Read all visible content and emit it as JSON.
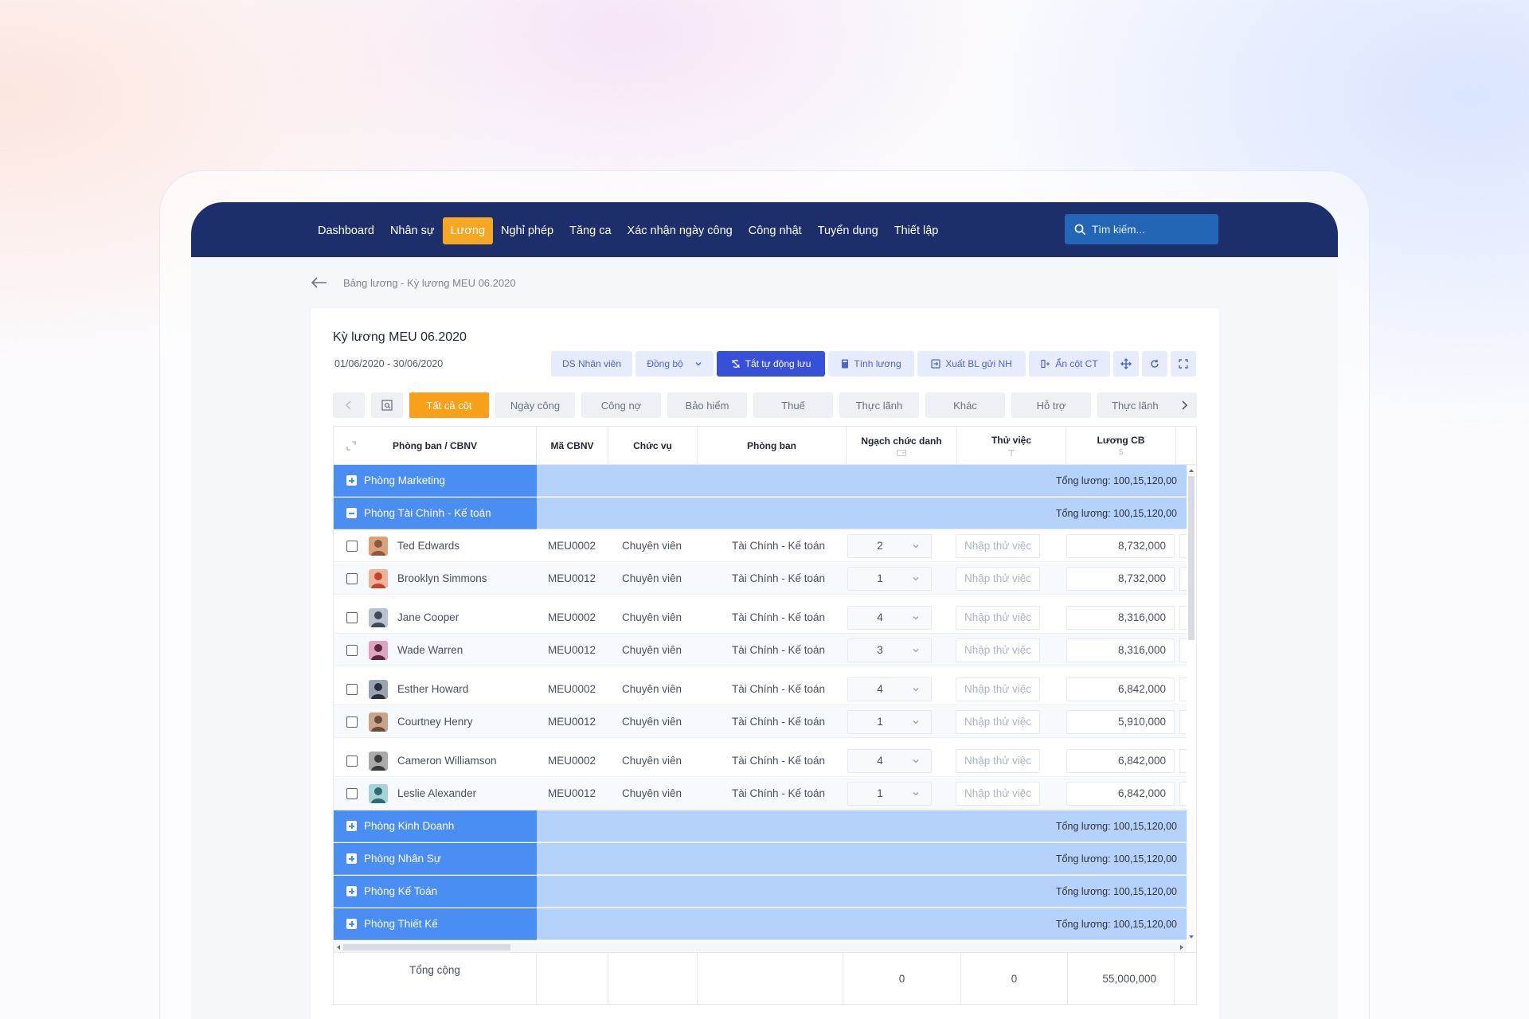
{
  "nav": {
    "items": [
      "Dashboard",
      "Nhân sự",
      "Lương",
      "Nghỉ phép",
      "Tăng ca",
      "Xác nhận ngày công",
      "Công nhật",
      "Tuyển dụng",
      "Thiết lập"
    ],
    "active_index": 2
  },
  "search": {
    "placeholder": "Tìm kiếm..."
  },
  "breadcrumb": "Bảng lương - Kỳ lương MEU 06.2020",
  "card": {
    "title": "Kỳ lương MEU 06.2020",
    "date_range": "01/06/2020 - 30/06/2020"
  },
  "toolbar": {
    "ds_nhan_vien": "DS Nhân viên",
    "dong_bo": "Đồng bộ",
    "tat_tu_dong_luu": "Tắt tự động lưu",
    "tinh_luong": "Tính lương",
    "xuat_bl": "Xuất BL gửi NH",
    "an_cot": "Ẩn cột CT"
  },
  "tabs": [
    "Tất cả cột",
    "Ngày công",
    "Công nợ",
    "Bảo hiểm",
    "Thuế",
    "Thực lãnh",
    "Khác",
    "Hỗ trợ",
    "Thực lãnh"
  ],
  "table": {
    "headers": {
      "dept_employee": "Phòng ban / CBNV",
      "code": "Mã CBNV",
      "position": "Chức vụ",
      "department": "Phòng ban",
      "grade": "Ngạch chức danh",
      "probation": "Thử việc",
      "base_salary": "Lương CB",
      "salary_unit": "$"
    },
    "groups": {
      "marketing": {
        "name": "Phòng Marketing",
        "total": "Tổng lương: 100,15,120,00"
      },
      "finance": {
        "name": "Phòng Tài Chính - Kế toán",
        "total": "Tổng lương: 100,15,120,00"
      },
      "sales": {
        "name": "Phòng  Kinh Doanh",
        "total": "Tổng lương: 100,15,120,00"
      },
      "hr": {
        "name": "Phòng Nhân Sự",
        "total": "Tổng lương: 100,15,120,00"
      },
      "accounting": {
        "name": "Phòng Kế Toán",
        "total": "Tổng lương: 100,15,120,00"
      },
      "design": {
        "name": "Phòng Thiết Kế",
        "total": "Tổng lương: 100,15,120,00"
      }
    },
    "probation_placeholder": "Nhập thử việc",
    "employees": [
      {
        "name": "Ted Edwards",
        "code": "MEU0002",
        "position": "Chuyên viên",
        "department": "Tài Chính - Kế toán",
        "grade": "2",
        "salary": "8,732,000"
      },
      {
        "name": "Brooklyn Simmons",
        "code": "MEU0012",
        "position": "Chuyên viên",
        "department": "Tài Chính - Kế toán",
        "grade": "1",
        "salary": "8,732,000"
      },
      {
        "name": "Jane Cooper",
        "code": "MEU0002",
        "position": "Chuyên viên",
        "department": "Tài Chính - Kế toán",
        "grade": "4",
        "salary": "8,316,000"
      },
      {
        "name": "Wade Warren",
        "code": "MEU0012",
        "position": "Chuyên viên",
        "department": "Tài Chính - Kế toán",
        "grade": "3",
        "salary": "8,316,000"
      },
      {
        "name": "Esther Howard",
        "code": "MEU0002",
        "position": "Chuyên viên",
        "department": "Tài Chính - Kế toán",
        "grade": "4",
        "salary": "6,842,000"
      },
      {
        "name": "Courtney Henry",
        "code": "MEU0012",
        "position": "Chuyên viên",
        "department": "Tài Chính - Kế toán",
        "grade": "1",
        "salary": "5,910,000"
      },
      {
        "name": "Cameron Williamson",
        "code": "MEU0002",
        "position": "Chuyên viên",
        "department": "Tài Chính - Kế toán",
        "grade": "4",
        "salary": "6,842,000"
      },
      {
        "name": "Leslie Alexander",
        "code": "MEU0012",
        "position": "Chuyên viên",
        "department": "Tài Chính - Kế toán",
        "grade": "1",
        "salary": "6,842,000"
      }
    ],
    "footer": {
      "label": "Tổng cộng",
      "grade_total": "0",
      "probation_total": "0",
      "salary_total": "55,000,000"
    }
  },
  "colors": {
    "navbar": "#1d2f6b",
    "accent": "#f5a623",
    "primary_button": "#3650d8",
    "group_row": "#4a8ef4",
    "group_total_bg": "#b5d2fb"
  }
}
